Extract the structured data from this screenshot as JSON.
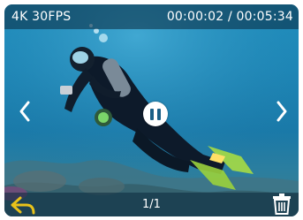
{
  "status": {
    "resolution": "4K 30FPS",
    "time": "00:00:02 / 00:05:34"
  },
  "playback": {
    "page_counter": "1/1",
    "state_icon": "pause-icon"
  },
  "icons": {
    "prev": "chevron-left-icon",
    "next": "chevron-right-icon",
    "back": "back-arrow-icon",
    "delete": "trash-icon"
  },
  "colors": {
    "water": "#1d86b6",
    "back_icon": "#e8c21a",
    "overlay_bar": "#0a283c"
  }
}
